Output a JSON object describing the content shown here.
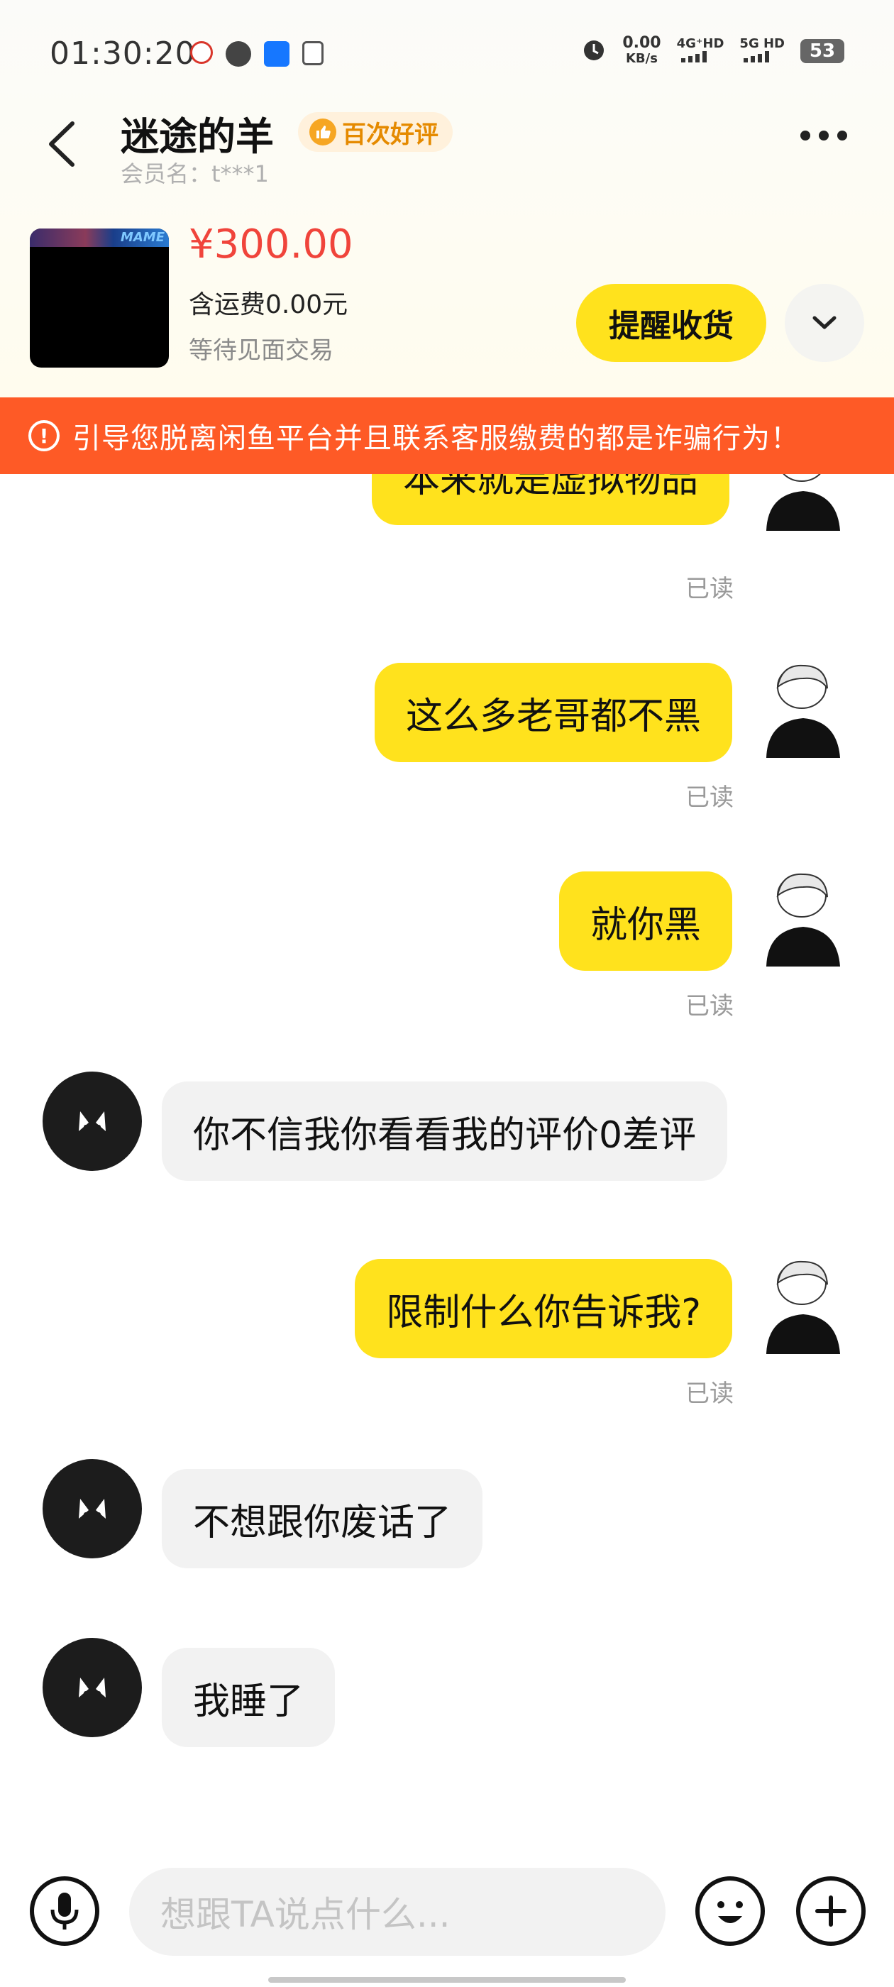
{
  "status_bar": {
    "time": "01:30:20",
    "net_speed_value": "0.00",
    "net_speed_unit": "KB/s",
    "signal1": "4G⁺HD",
    "signal2": "5G HD",
    "battery": "53"
  },
  "header": {
    "seller_name": "迷途的羊",
    "badge_label": "百次好评",
    "member_label": "会员名：t***1"
  },
  "product": {
    "thumb_text": "MAME",
    "price": "¥300.00",
    "shipping": "含运费0.00元",
    "status": "等待见面交易",
    "remind_button": "提醒收货"
  },
  "warning_banner": {
    "text": "引导您脱离闲鱼平台并且联系客服缴费的都是诈骗行为！"
  },
  "messages": [
    {
      "from": "me",
      "text": "本来就是虚拟物品",
      "read": "已读"
    },
    {
      "from": "me",
      "text": "这么多老哥都不黑",
      "read": "已读"
    },
    {
      "from": "me",
      "text": "就你黑",
      "read": "已读"
    },
    {
      "from": "other",
      "text": "你不信我你看看我的评价0差评"
    },
    {
      "from": "me",
      "text": "限制什么你告诉我?",
      "read": "已读"
    },
    {
      "from": "other",
      "text": "不想跟你废话了"
    },
    {
      "from": "other",
      "text": "我睡了"
    }
  ],
  "input_bar": {
    "placeholder": "想跟TA说点什么..."
  },
  "colors": {
    "accent_yellow": "#ffe21d",
    "price_red": "#f0443b",
    "warning_orange": "#fe5a26",
    "badge_orange": "#e58a00"
  }
}
